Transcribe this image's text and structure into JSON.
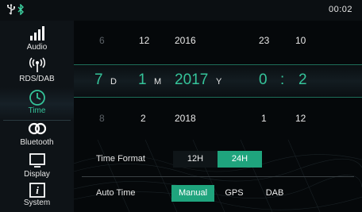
{
  "status": {
    "clock": "00:02",
    "icons": [
      "usb-icon",
      "bluetooth-icon"
    ]
  },
  "sidebar": {
    "items": [
      {
        "label": "Audio",
        "icon": "equalizer-bars-icon"
      },
      {
        "label": "RDS/DAB",
        "icon": "radio-signal-icon"
      },
      {
        "label": "Time",
        "icon": "clock-icon",
        "active": true
      },
      {
        "label": "Bluetooth",
        "icon": "bluetooth-link-icon"
      },
      {
        "label": "Display",
        "icon": "display-icon"
      },
      {
        "label": "System",
        "icon": "info-icon"
      }
    ]
  },
  "picker": {
    "prev": {
      "day": "6",
      "month": "12",
      "year": "2016",
      "hour": "23",
      "minute": "10"
    },
    "current": {
      "day": "7",
      "month": "1",
      "year": "2017",
      "hour": "0",
      "minute": "2"
    },
    "next": {
      "day": "8",
      "month": "2",
      "year": "2018",
      "hour": "1",
      "minute": "12"
    },
    "units": {
      "day": "D",
      "month": "M",
      "year": "Y",
      "separator": ":"
    }
  },
  "time_format": {
    "label": "Time Format",
    "options": [
      "12H",
      "24H"
    ],
    "selected": "24H"
  },
  "auto_time": {
    "label": "Auto Time",
    "options": [
      "Manual",
      "GPS",
      "DAB"
    ],
    "selected": "Manual"
  },
  "colors": {
    "accent": "#35c49a",
    "button_active": "#1fa47d",
    "background": "#05080a",
    "sidebar": "#0e1317"
  }
}
